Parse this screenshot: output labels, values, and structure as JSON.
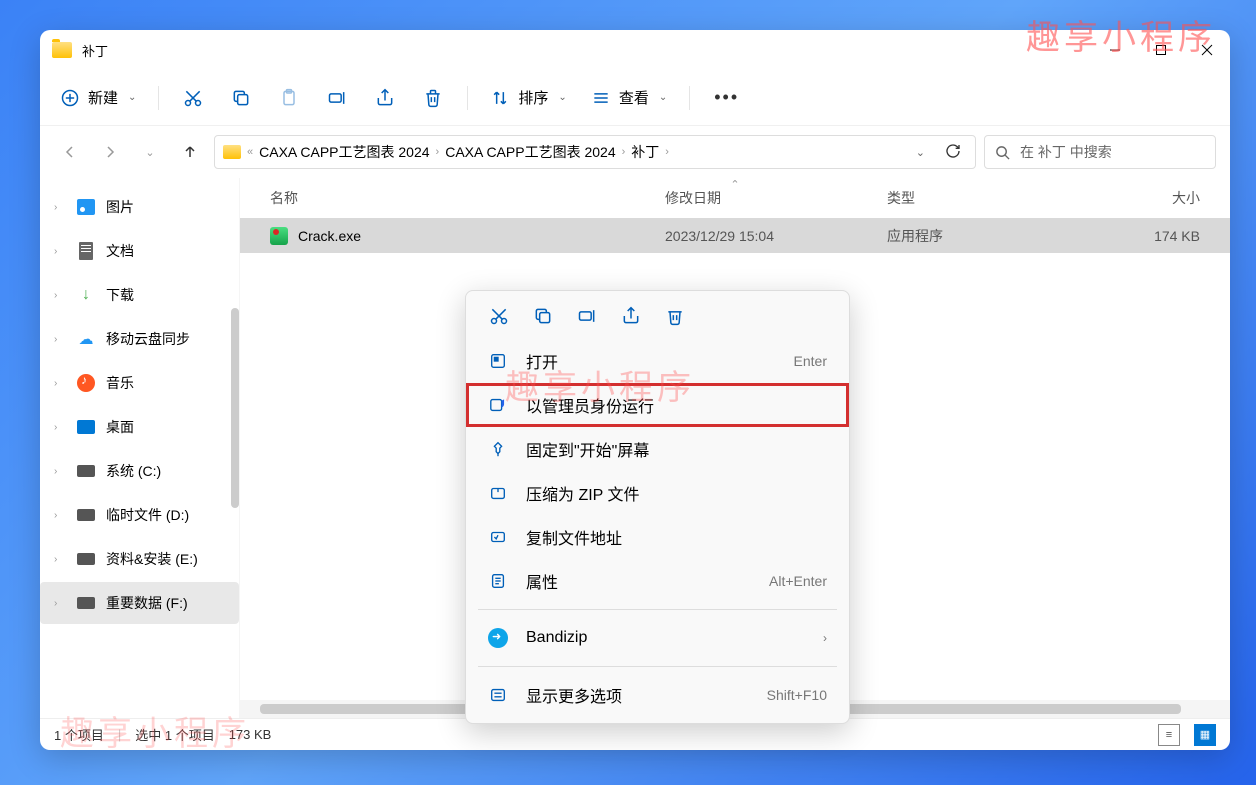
{
  "window": {
    "title": "补丁"
  },
  "watermark": "趣享小程序",
  "toolbar": {
    "new": "新建",
    "sort": "排序",
    "view": "查看"
  },
  "breadcrumb": {
    "items": [
      "CAXA CAPP工艺图表 2024",
      "CAXA CAPP工艺图表 2024",
      "补丁"
    ]
  },
  "search": {
    "placeholder": "在 补丁 中搜索"
  },
  "sidebar": {
    "items": [
      {
        "label": "图片"
      },
      {
        "label": "文档"
      },
      {
        "label": "下载"
      },
      {
        "label": "移动云盘同步"
      },
      {
        "label": "音乐"
      },
      {
        "label": "桌面"
      },
      {
        "label": "系统 (C:)"
      },
      {
        "label": "临时文件 (D:)"
      },
      {
        "label": "资料&安装 (E:)"
      },
      {
        "label": "重要数据 (F:)"
      }
    ]
  },
  "columns": {
    "name": "名称",
    "date": "修改日期",
    "type": "类型",
    "size": "大小"
  },
  "files": [
    {
      "name": "Crack.exe",
      "date": "2023/12/29 15:04",
      "type": "应用程序",
      "size": "174 KB"
    }
  ],
  "context": {
    "open": "打开",
    "open_key": "Enter",
    "admin": "以管理员身份运行",
    "pin": "固定到\"开始\"屏幕",
    "zip": "压缩为 ZIP 文件",
    "copypath": "复制文件地址",
    "props": "属性",
    "props_key": "Alt+Enter",
    "bandizip": "Bandizip",
    "more": "显示更多选项",
    "more_key": "Shift+F10"
  },
  "status": {
    "count": "1 个项目",
    "selected": "选中 1 个项目",
    "size": "173 KB"
  }
}
